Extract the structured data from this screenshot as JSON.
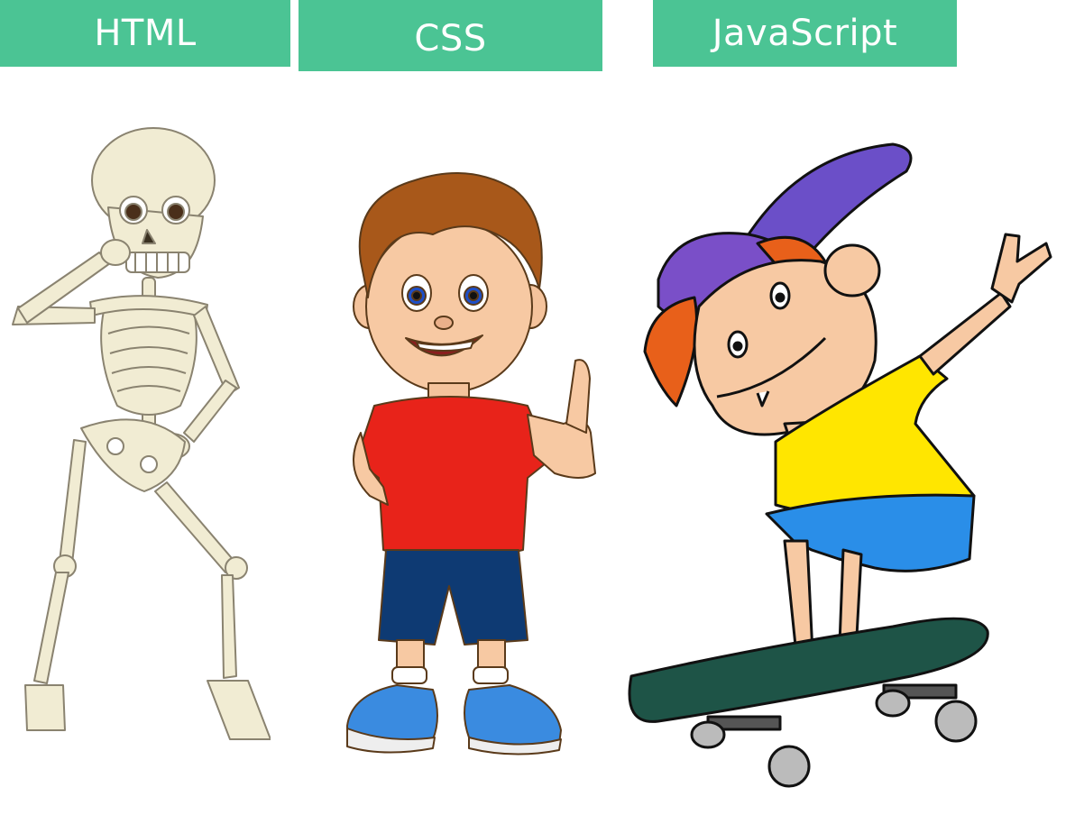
{
  "labels": {
    "html": "HTML",
    "css": "CSS",
    "javascript": "JavaScript"
  },
  "colors": {
    "label_background": "#4bc494",
    "label_text": "#ffffff",
    "bone": "#f1ecd3",
    "shirt_red": "#e8231a",
    "shorts_navy": "#0e3a73",
    "shirt_yellow": "#ffe600",
    "cap_purple": "#7a4fc8",
    "hair_orange": "#e8601a",
    "skateboard_green": "#1e5447",
    "shoe_red": "#e62020",
    "shoe_blue": "#3a8be0"
  },
  "figures": {
    "skeleton": "skeleton-illustration",
    "boy": "boy-thumbs-up-illustration",
    "skater": "skateboarder-illustration"
  }
}
